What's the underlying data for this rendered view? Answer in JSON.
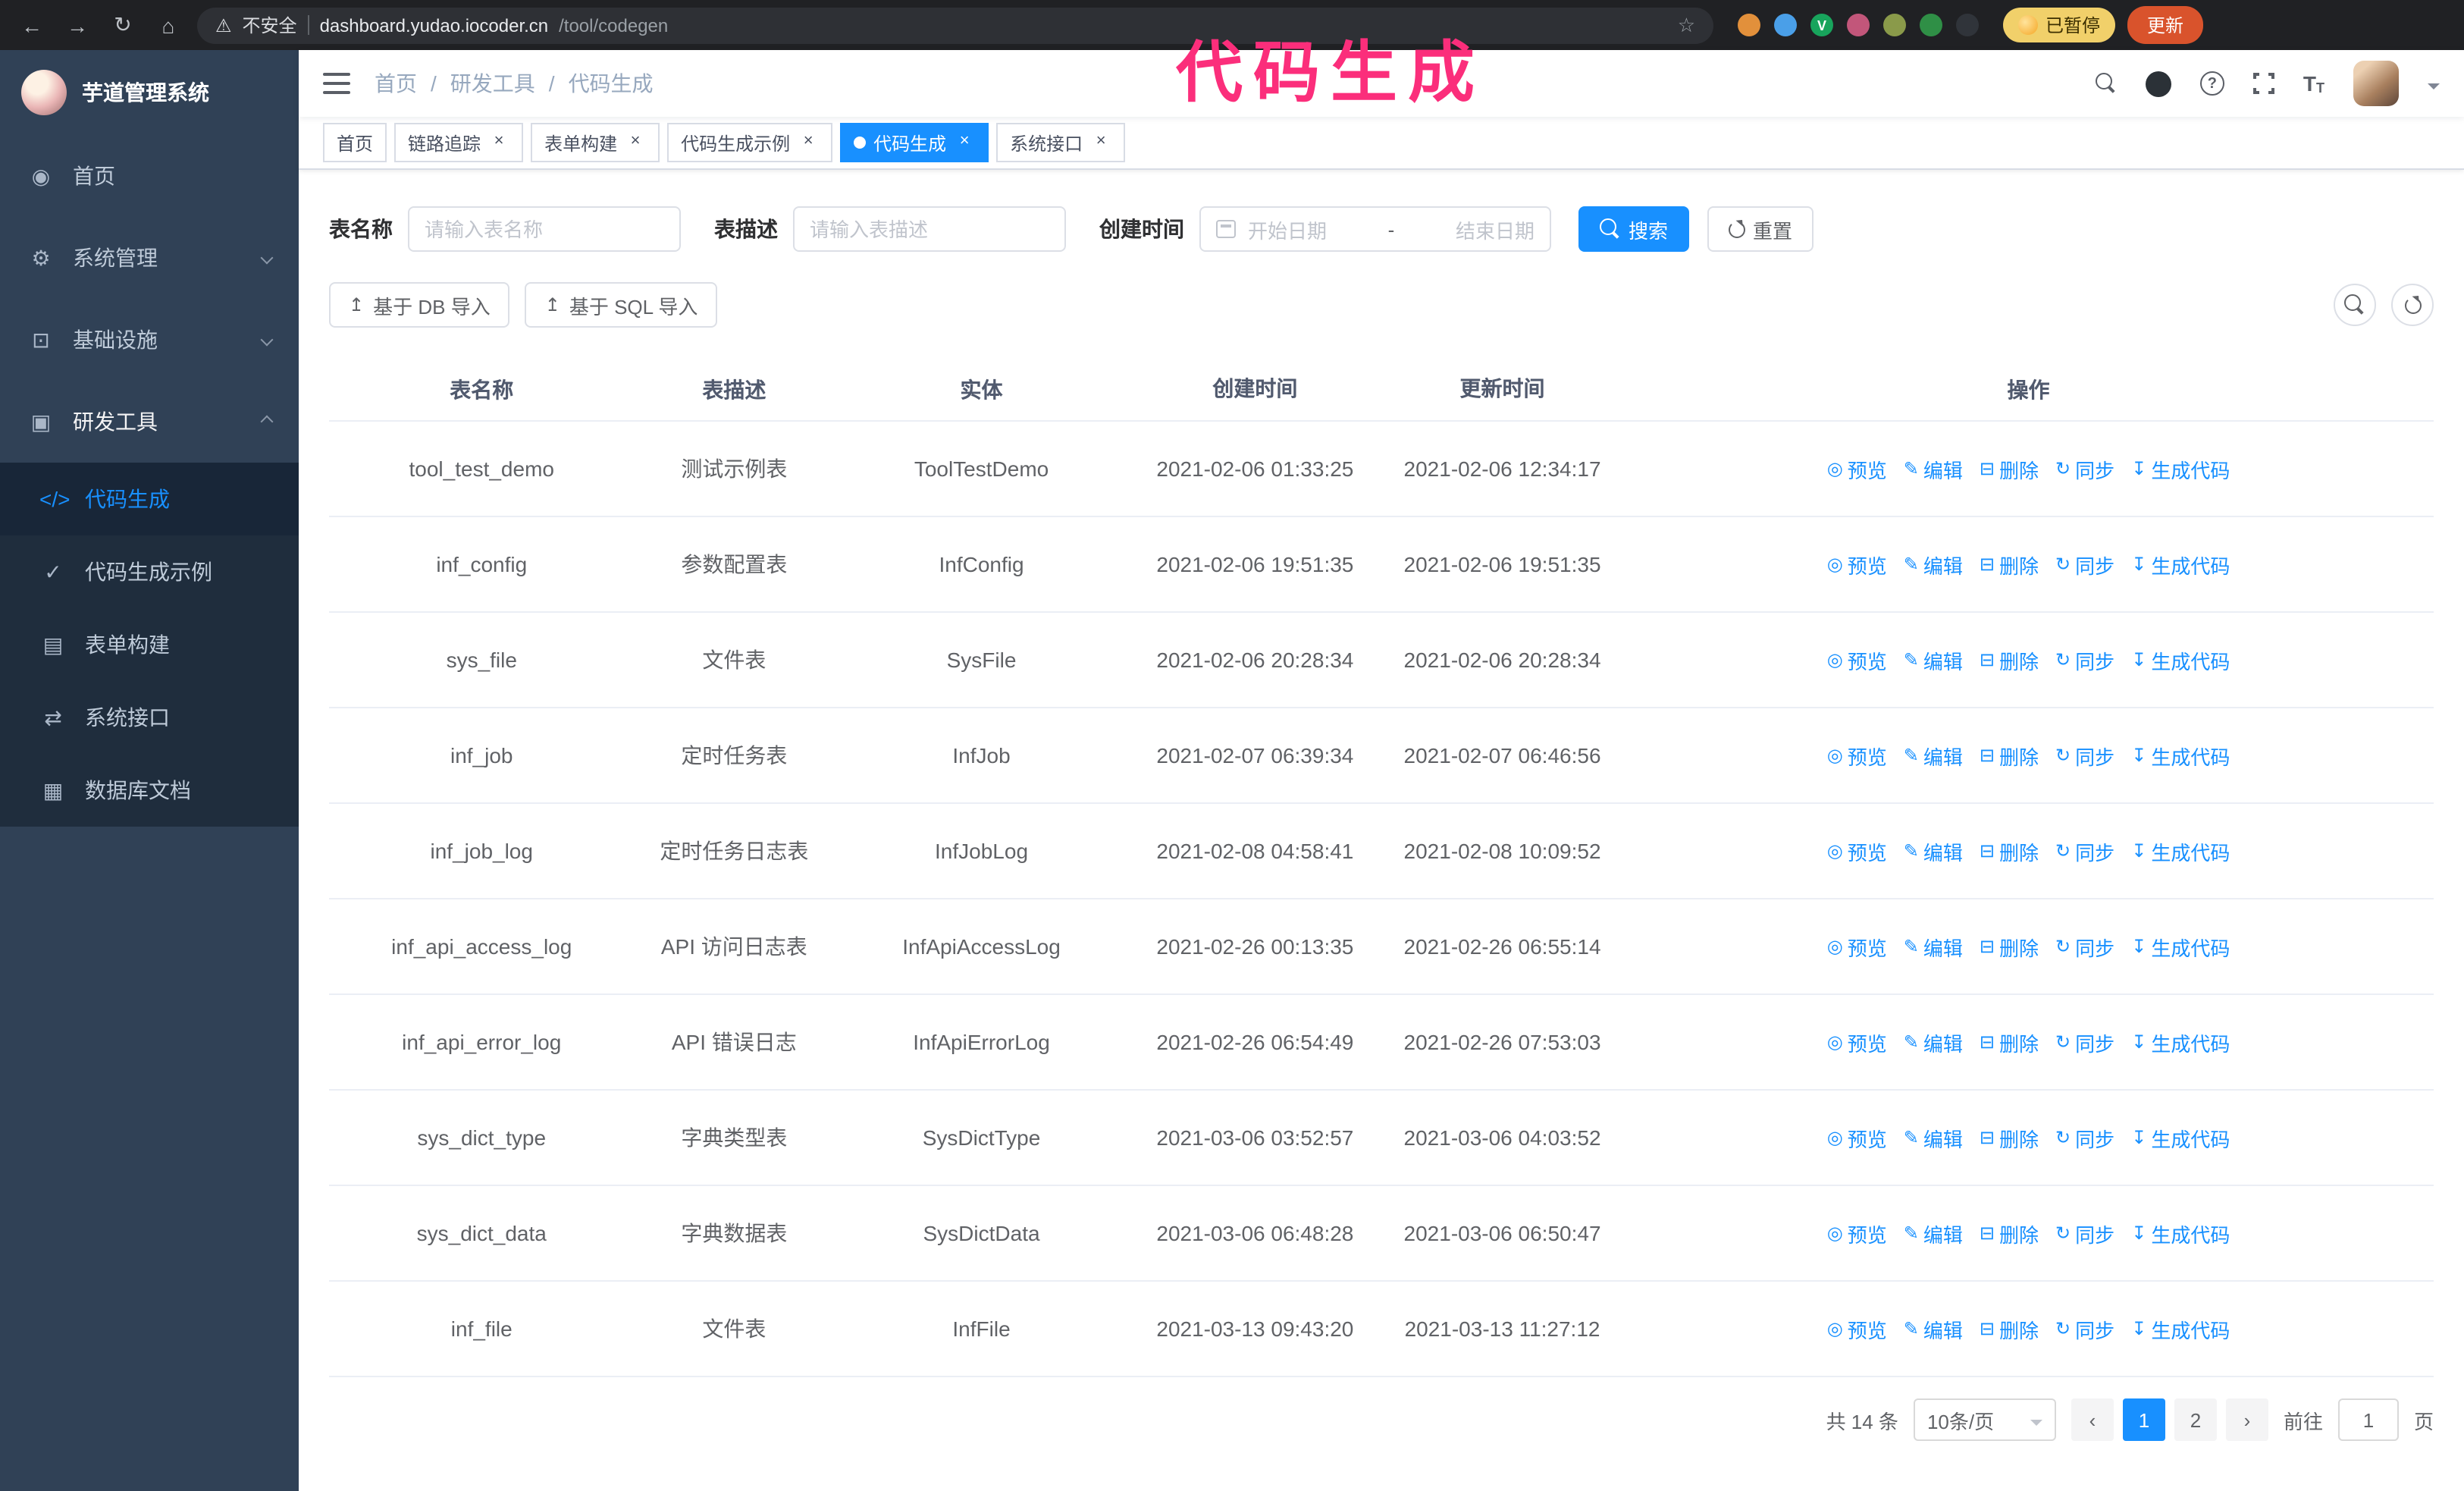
{
  "annotation": {
    "text": "代码生成",
    "color": "#fb2e7b"
  },
  "browser": {
    "security_warning": "不安全",
    "url_host": "dashboard.yudao.iocoder.cn",
    "url_path": "/tool/codegen",
    "paused_badge": "已暂停",
    "update_button": "更新",
    "extensions": [
      {
        "name": "extension-icon",
        "color": "#e2903b"
      },
      {
        "name": "extension-icon",
        "color": "#4a9fe8"
      },
      {
        "name": "extension-icon",
        "color": "#18a45c",
        "letter": "V"
      },
      {
        "name": "extension-icon",
        "color": "#c2567a"
      },
      {
        "name": "extension-icon",
        "color": "#8a9a4a"
      },
      {
        "name": "extension-icon",
        "color": "#2f8f46"
      },
      {
        "name": "extension-icon",
        "color": "#30343a"
      }
    ]
  },
  "sidebar": {
    "logo_title": "芋道管理系统",
    "items": [
      {
        "id": "home",
        "label": "首页",
        "icon": "dashboard-icon",
        "glyph": "◉"
      },
      {
        "id": "system",
        "label": "系统管理",
        "icon": "gear-icon",
        "glyph": "⚙",
        "expandable": true
      },
      {
        "id": "infra",
        "label": "基础设施",
        "icon": "monitor-icon",
        "glyph": "⊡",
        "expandable": true
      },
      {
        "id": "dev-tools",
        "label": "研发工具",
        "icon": "toolbox-icon",
        "glyph": "▣",
        "expandable": true,
        "expanded": true,
        "children": [
          {
            "id": "codegen",
            "label": "代码生成",
            "icon": "code-icon",
            "glyph": "</>",
            "active": true
          },
          {
            "id": "codegen-example",
            "label": "代码生成示例",
            "icon": "badge-check-icon",
            "glyph": "✓"
          },
          {
            "id": "form-builder",
            "label": "表单构建",
            "icon": "form-icon",
            "glyph": "▤"
          },
          {
            "id": "api",
            "label": "系统接口",
            "icon": "sliders-icon",
            "glyph": "⇄"
          },
          {
            "id": "db-doc",
            "label": "数据库文档",
            "icon": "grid-icon",
            "glyph": "▦"
          }
        ]
      }
    ]
  },
  "header": {
    "breadcrumb": [
      "首页",
      "研发工具",
      "代码生成"
    ],
    "separator": "/"
  },
  "tags": [
    {
      "id": "home",
      "label": "首页",
      "closable": false
    },
    {
      "id": "tracer",
      "label": "链路追踪",
      "closable": true
    },
    {
      "id": "form-builder",
      "label": "表单构建",
      "closable": true
    },
    {
      "id": "codegen-example",
      "label": "代码生成示例",
      "closable": true
    },
    {
      "id": "codegen",
      "label": "代码生成",
      "closable": true,
      "active": true
    },
    {
      "id": "api",
      "label": "系统接口",
      "closable": true
    }
  ],
  "filters": {
    "table_name_label": "表名称",
    "table_name_placeholder": "请输入表名称",
    "table_desc_label": "表描述",
    "table_desc_placeholder": "请输入表描述",
    "create_time_label": "创建时间",
    "date_start_placeholder": "开始日期",
    "date_separator": "-",
    "date_end_placeholder": "结束日期",
    "search_button": "搜索",
    "reset_button": "重置"
  },
  "toolbar": {
    "buttons": [
      {
        "id": "import-db",
        "label": "基于 DB 导入",
        "icon": "upload-icon",
        "glyph": "↥"
      },
      {
        "id": "import-sql",
        "label": "基于 SQL 导入",
        "icon": "upload-icon",
        "glyph": "↥"
      }
    ]
  },
  "table": {
    "columns": [
      "表名称",
      "表描述",
      "实体",
      "创建时间",
      "更新时间",
      "操作"
    ],
    "row_actions": [
      {
        "id": "preview",
        "label": "预览",
        "icon": "eye-icon",
        "glyph": "◎"
      },
      {
        "id": "edit",
        "label": "编辑",
        "icon": "edit-icon",
        "glyph": "✎"
      },
      {
        "id": "delete",
        "label": "删除",
        "icon": "trash-icon",
        "glyph": "⊟"
      },
      {
        "id": "sync",
        "label": "同步",
        "icon": "sync-icon",
        "glyph": "↻"
      },
      {
        "id": "generate",
        "label": "生成代码",
        "icon": "download-icon",
        "glyph": "↧"
      }
    ],
    "rows": [
      {
        "name": "tool_test_demo",
        "desc": "测试示例表",
        "entity": "ToolTestDemo",
        "created": "2021-02-06 01:33:25",
        "updated": "2021-02-06 12:34:17"
      },
      {
        "name": "inf_config",
        "desc": "参数配置表",
        "entity": "InfConfig",
        "created": "2021-02-06 19:51:35",
        "updated": "2021-02-06 19:51:35"
      },
      {
        "name": "sys_file",
        "desc": "文件表",
        "entity": "SysFile",
        "created": "2021-02-06 20:28:34",
        "updated": "2021-02-06 20:28:34"
      },
      {
        "name": "inf_job",
        "desc": "定时任务表",
        "entity": "InfJob",
        "created": "2021-02-07 06:39:34",
        "updated": "2021-02-07 06:46:56"
      },
      {
        "name": "inf_job_log",
        "desc": "定时任务日志表",
        "entity": "InfJobLog",
        "created": "2021-02-08 04:58:41",
        "updated": "2021-02-08 10:09:52"
      },
      {
        "name": "inf_api_access_log",
        "desc": "API 访问日志表",
        "entity": "InfApiAccessLog",
        "created": "2021-02-26 00:13:35",
        "updated": "2021-02-26 06:55:14"
      },
      {
        "name": "inf_api_error_log",
        "desc": "API 错误日志",
        "entity": "InfApiErrorLog",
        "created": "2021-02-26 06:54:49",
        "updated": "2021-02-26 07:53:03"
      },
      {
        "name": "sys_dict_type",
        "desc": "字典类型表",
        "entity": "SysDictType",
        "created": "2021-03-06 03:52:57",
        "updated": "2021-03-06 04:03:52"
      },
      {
        "name": "sys_dict_data",
        "desc": "字典数据表",
        "entity": "SysDictData",
        "created": "2021-03-06 06:48:28",
        "updated": "2021-03-06 06:50:47"
      },
      {
        "name": "inf_file",
        "desc": "文件表",
        "entity": "InfFile",
        "created": "2021-03-13 09:43:20",
        "updated": "2021-03-13 11:27:12"
      }
    ]
  },
  "pagination": {
    "total": "共 14 条",
    "page_size": "10条/页",
    "pages": [
      {
        "label": "1",
        "active": true
      },
      {
        "label": "2"
      }
    ],
    "prev_icon": "‹",
    "next_icon": "›",
    "goto_label": "前往",
    "goto_value": "1",
    "goto_suffix": "页"
  },
  "ui": {
    "close_glyph": "×",
    "accent": "#1890ff"
  }
}
